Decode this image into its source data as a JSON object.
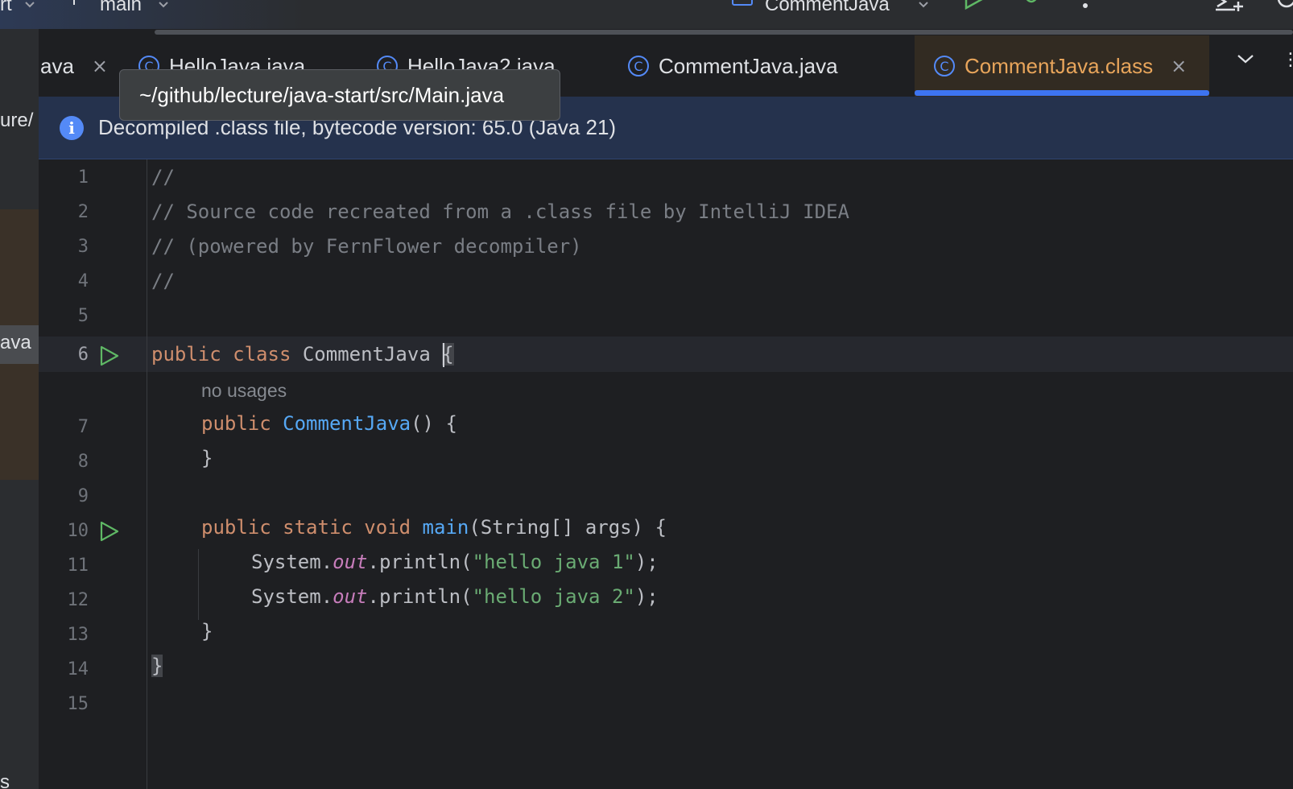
{
  "toolbar": {
    "left_fragment": "rt",
    "branch_label": "main",
    "run_config_label": "CommentJava"
  },
  "project_panel": {
    "path_fragment": "ure/",
    "selected_fragment": "ava"
  },
  "tabs": [
    {
      "label": "ava",
      "closable": true,
      "active": false
    },
    {
      "label": "HelloJava.java",
      "active": false
    },
    {
      "label": "HelloJava2.java",
      "active": false
    },
    {
      "label": "CommentJava.java",
      "active": false
    },
    {
      "label": "CommentJava.class",
      "closable": true,
      "active": true
    }
  ],
  "tab_icon_glyph": "C",
  "close_glyph": "×",
  "tooltip": {
    "text": "~/github/lecture/java-start/src/Main.java"
  },
  "banner": {
    "icon": "info-icon",
    "text": "Decompiled .class file, bytecode version: 65.0 (Java 21)"
  },
  "editor": {
    "line_numbers": [
      "1",
      "2",
      "3",
      "4",
      "5",
      "6",
      "7",
      "8",
      "9",
      "10",
      "11",
      "12",
      "13",
      "14",
      "15"
    ],
    "current_line": "6",
    "inlay_hint": "no usages",
    "lines": {
      "l1": "//",
      "l2": "// Source code recreated from a .class file by IntelliJ IDEA",
      "l3": "// (powered by FernFlower decompiler)",
      "l4": "//",
      "l6_kw": "public class",
      "l6_name": " CommentJava ",
      "l6_brace": "{",
      "l7_kw": "public",
      "l7_fn": "CommentJava",
      "l7_rest": "() {",
      "l8": "}",
      "l10_kw": "public static void",
      "l10_fn": "main",
      "l10_rest": "(String[] args) {",
      "l11_a": "System.",
      "l11_fld": "out",
      "l11_b": ".println(",
      "l11_str": "\"hello java 1\"",
      "l11_c": ");",
      "l12_a": "System.",
      "l12_fld": "out",
      "l12_b": ".println(",
      "l12_str": "\"hello java 2\"",
      "l12_c": ");",
      "l13": "}",
      "l14": "}"
    }
  },
  "colors": {
    "keyword": "#cf8e6d",
    "function": "#56a8f5",
    "string": "#6aab73",
    "comment": "#7a7e85",
    "field": "#c77dbb",
    "active_tab_text": "#e8a55b",
    "accent": "#3d74f2"
  }
}
